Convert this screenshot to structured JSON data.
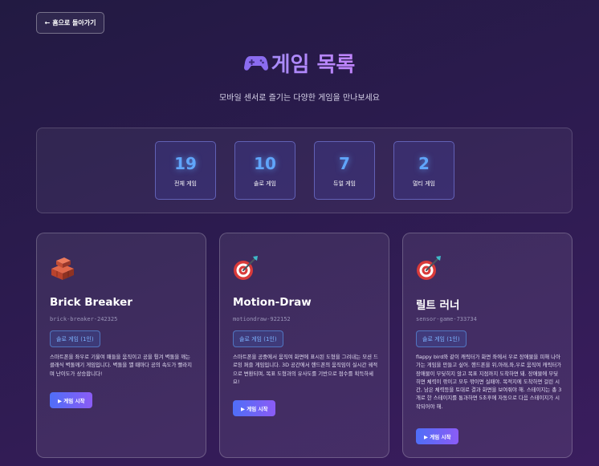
{
  "back_button": {
    "arrow": "←",
    "label": "홈으로 돌아가기"
  },
  "header": {
    "icon": "gamepad-icon",
    "title": "게임 목록",
    "subtitle": "모바일 센서로 즐기는 다양한 게임을 만나보세요"
  },
  "colors": {
    "accent_blue": "#60a5fa",
    "title_purple": "#a78bfa",
    "button_start": "#4f6ef7",
    "button_end": "#8b5cf6"
  },
  "stats": [
    {
      "value": "19",
      "label": "전체 게임"
    },
    {
      "value": "10",
      "label": "솔로 게임"
    },
    {
      "value": "7",
      "label": "듀얼 게임"
    },
    {
      "value": "2",
      "label": "멀티 게임"
    }
  ],
  "games": [
    {
      "icon": "bricks-icon",
      "name": "Brick Breaker",
      "id": "brick-breaker-242325",
      "badge": "솔로 게임 (1인)",
      "description": "스마트폰을 좌우로 기울여 패들을 움직이고 공을 튕겨 벽돌을 깨는 클래식 벽돌깨기 게임입니다. 벽돌을 꺨 때마다 공의 속도가 빨라지며 난이도가 상승합니다!",
      "play_label": "▶ 게임 시작"
    },
    {
      "icon": "dart-target-icon",
      "name": "Motion-Draw",
      "id": "motiondraw-922152",
      "badge": "솔로 게임 (1인)",
      "description": "스마트폰을 공중에서 움직여 화면에 표시된 도형을 그려내는 모션 드로잉 퍼즐 게임입니다. 3D 공간에서 핸드폰의 움직임이 실시간 궤적으로 변환되며, 목표 도형과의 유사도를 기반으로 점수를 획득하세요!",
      "play_label": "▶ 게임 시작"
    },
    {
      "icon": "dart-target-icon",
      "name": "릴트 러너",
      "id": "sensor-game-733734",
      "badge": "솔로 게임 (1인)",
      "description": "flappy bird와 같이 캐릭터가 화면 좌에서 우로 장애물을 피해 나아가는 게임을 만들고 싶어. 핸드폰을 위,아래,좌,우로 움직여 캐릭터가 장애물이 부딪히지 않고 목표 지점까지 도착하면 돼. 장애물에 부딪히면 체력이 깎이고 모두 깎이면 실패야. 목적지에 도착하면 걸린 시간, 남은 체력등을 토대로 결과 화면을 보여줘야 해. 스테이지는 총 3개로 한 스테이지를 통과하면 5초후에 자동으로 다음 스테이지가 시작되어야 해.",
      "play_label": "▶ 게임 시작"
    }
  ]
}
